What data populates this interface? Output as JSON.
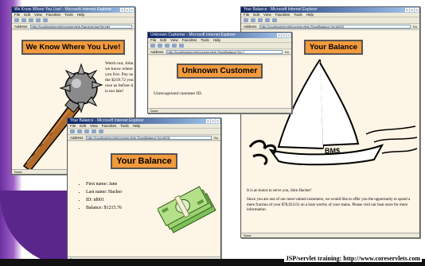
{
  "footer": {
    "credit": "JSP/servlet training: http://www.coreservlets.com"
  },
  "windows": {
    "left": {
      "title": "We Know Where You Live! - Microsoft Internet Explorer",
      "menu": [
        "File",
        "Edit",
        "View",
        "Favorites",
        "Tools",
        "Help"
      ],
      "address_label": "Address",
      "address": "http://localhost/servlet/coreservlets.RandomUserServlet",
      "heading": "We Know Where You Live!",
      "text": "Watch out, John, we know where you live. Pay us the $219.72 you owe us before it is too late!",
      "status": "Done"
    },
    "unknown": {
      "title": "Unknown Customer - Microsoft Internet Explorer",
      "menu": [
        "File",
        "Edit",
        "View",
        "Favorites",
        "Tools",
        "Help"
      ],
      "address_label": "Address",
      "address": "http://localhost/servlet/coreservlets.ShowBalance?id=7",
      "go": "Go",
      "heading": "Unknown Customer",
      "text": "Unrecognized customer ID.",
      "status": "Done"
    },
    "right": {
      "title": "Your Balance - Microsoft Internet Explorer",
      "menu": [
        "File",
        "Edit",
        "View",
        "Favorites",
        "Tools",
        "Help"
      ],
      "address_label": "Address",
      "address": "http://localhost/servlet/coreservlets.ShowBalance?id=id003",
      "go": "Go",
      "heading": "Your Balance",
      "text1": "It is an honor to serve you, John Hacker!",
      "text2": "Since you are one of our most valued customers, we would like to offer you the opportunity to spend a mere fraction of your $78,923.01 on a boat worthy of your status. Please visit our boat store for more information.",
      "status": "Done"
    },
    "bottom": {
      "title": "Your Balance - Microsoft Internet Explorer",
      "menu": [
        "File",
        "Edit",
        "View",
        "Favorites",
        "Tools",
        "Help"
      ],
      "address_label": "Address",
      "address": "http://localhost/servlet/coreservlets.ShowBalance?id=id001",
      "go": "Go",
      "heading": "Your Balance",
      "items": [
        "First name: Jane",
        "Last name: Hacker",
        "ID: id001",
        "Balance: $1215.76"
      ],
      "status": "Done"
    }
  }
}
